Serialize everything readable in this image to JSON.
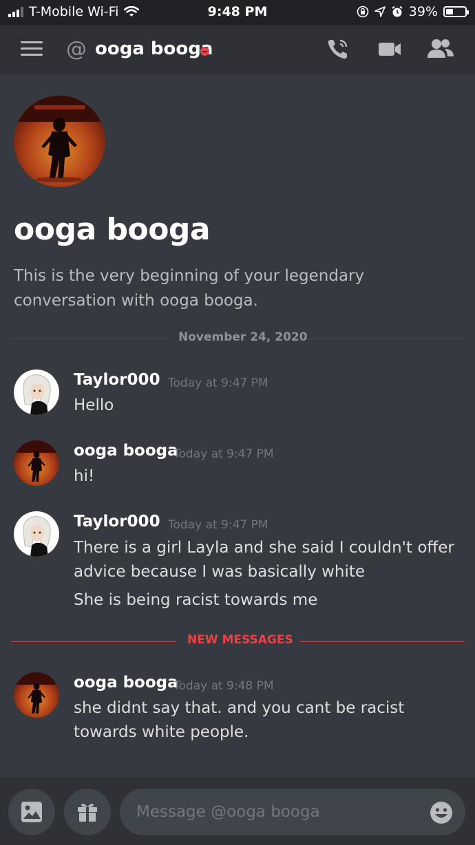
{
  "status_bar": {
    "carrier": "T-Mobile Wi-Fi",
    "time": "9:48 PM",
    "battery_text": "39%",
    "battery_level": 0.39
  },
  "header": {
    "at_symbol": "@",
    "title": "ooga booga",
    "icons": [
      "menu-icon",
      "phone-call-icon",
      "video-camera-icon",
      "members-icon"
    ]
  },
  "intro": {
    "title": "ooga booga",
    "description": "This is the very beginning of your legendary conversation with ooga booga."
  },
  "date_divider": "November 24, 2020",
  "messages": [
    {
      "author": "Taylor000",
      "timestamp": "Today at 9:47 PM",
      "lines": [
        "Hello"
      ]
    },
    {
      "author": "ooga booga",
      "timestamp": "Today at 9:47 PM",
      "lines": [
        "hi!"
      ]
    },
    {
      "author": "Taylor000",
      "timestamp": "Today at 9:47 PM",
      "lines": [
        "There is a girl Layla and she said I couldn't offer advice because I was basically white",
        "She is being racist towards me"
      ]
    },
    {
      "author": "ooga booga",
      "timestamp": "Today at 9:48 PM",
      "lines": [
        "she didnt say that. and you cant be racist towards white people."
      ]
    }
  ],
  "new_messages_label": "NEW MESSAGES",
  "composer": {
    "placeholder": "Message @ooga booga",
    "icons": [
      "image-icon",
      "gift-icon",
      "emoji-icon"
    ]
  },
  "colors": {
    "background": "#36393f",
    "header": "#2f3136",
    "accent_red": "#ed4245",
    "muted_text": "#72767d"
  }
}
